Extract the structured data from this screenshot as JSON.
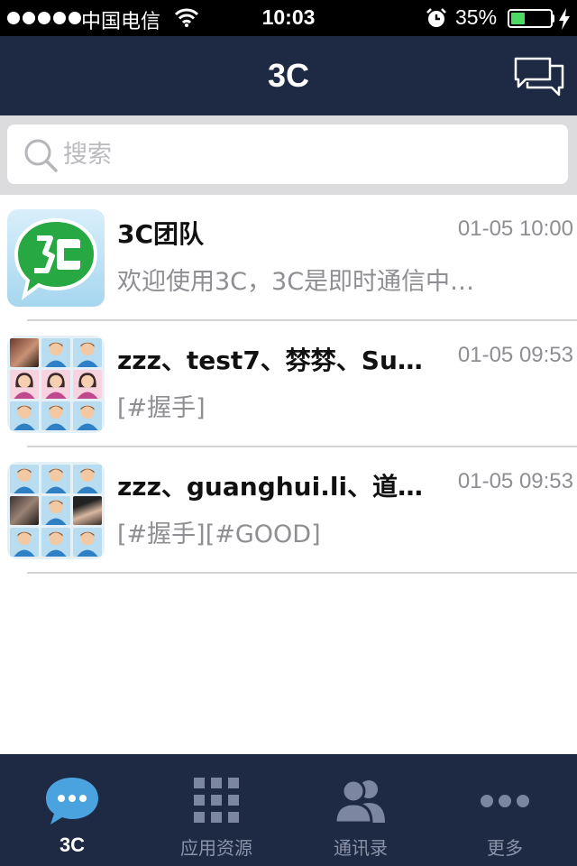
{
  "status_bar": {
    "carrier": "中国电信",
    "time": "10:03",
    "battery_percent": "35%",
    "battery_level": 0.35
  },
  "nav": {
    "title": "3C",
    "chat_icon": "chat-bubbles-icon"
  },
  "search": {
    "placeholder": "搜索",
    "value": ""
  },
  "conversations": [
    {
      "title": "3C团队",
      "time": "01-05 10:00",
      "preview": "欢迎使用3C，3C是即时通信中…",
      "avatar": "3c-logo"
    },
    {
      "title": "zzz、test7、棼棼、Su…",
      "time": "01-05 09:53",
      "preview": "[#握手]",
      "avatar": "group-avatar"
    },
    {
      "title": "zzz、guanghui.li、道…",
      "time": "01-05 09:53",
      "preview": "[#握手][#GOOD]",
      "avatar": "group-avatar"
    }
  ],
  "tabs": [
    {
      "label": "3C",
      "icon": "chat-bubble-icon",
      "active": true
    },
    {
      "label": "应用资源",
      "icon": "grid-icon",
      "active": false
    },
    {
      "label": "通讯录",
      "icon": "contacts-icon",
      "active": false
    },
    {
      "label": "更多",
      "icon": "more-icon",
      "active": false
    }
  ],
  "colors": {
    "nav_bg": "#1e2a44",
    "tab_active": "#4aa3df",
    "tab_inactive": "#8b93a8",
    "logo_green": "#2bb24c"
  }
}
